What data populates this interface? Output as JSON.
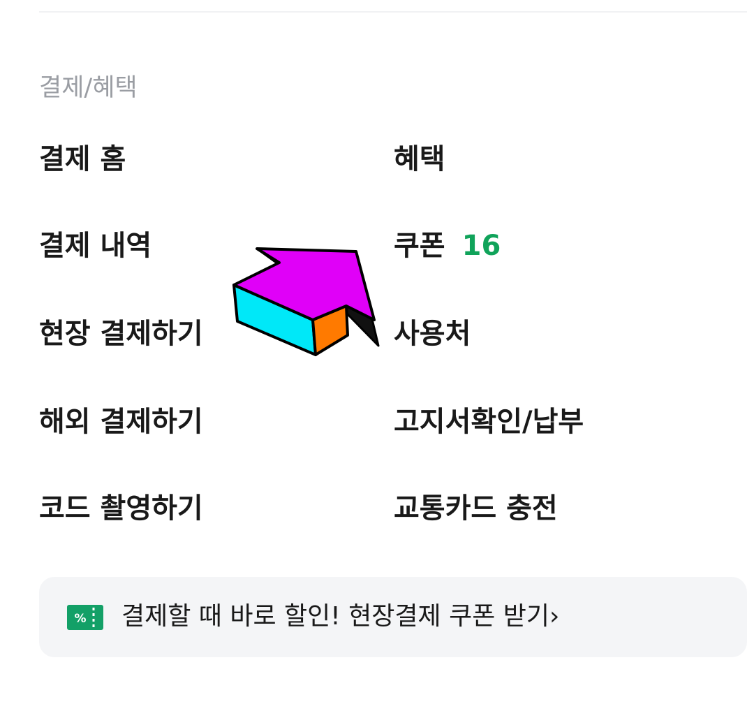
{
  "section": {
    "title": "결제/혜택"
  },
  "menu": {
    "left": [
      {
        "label": "결제 홈"
      },
      {
        "label": "결제 내역"
      },
      {
        "label": "현장 결제하기"
      },
      {
        "label": "해외 결제하기"
      },
      {
        "label": "코드 촬영하기"
      }
    ],
    "right": [
      {
        "label": "혜택"
      },
      {
        "label": "쿠폰",
        "count": "16"
      },
      {
        "label": "사용처"
      },
      {
        "label": "고지서확인/납부"
      },
      {
        "label": "교통카드 충전"
      }
    ]
  },
  "banner": {
    "icon": "coupon-percent-icon",
    "text": "결제할 때 바로 할인! 현장결제 쿠폰 받기",
    "chevron": "›"
  },
  "colors": {
    "badge_green": "#10a35a",
    "banner_bg": "#f4f5f7",
    "icon_green": "#13a067",
    "arrow_magenta": "#e000f8",
    "arrow_cyan": "#00e8f8",
    "arrow_orange": "#ff7a00"
  },
  "overlay": {
    "icon": "arrow-cursor-icon"
  }
}
